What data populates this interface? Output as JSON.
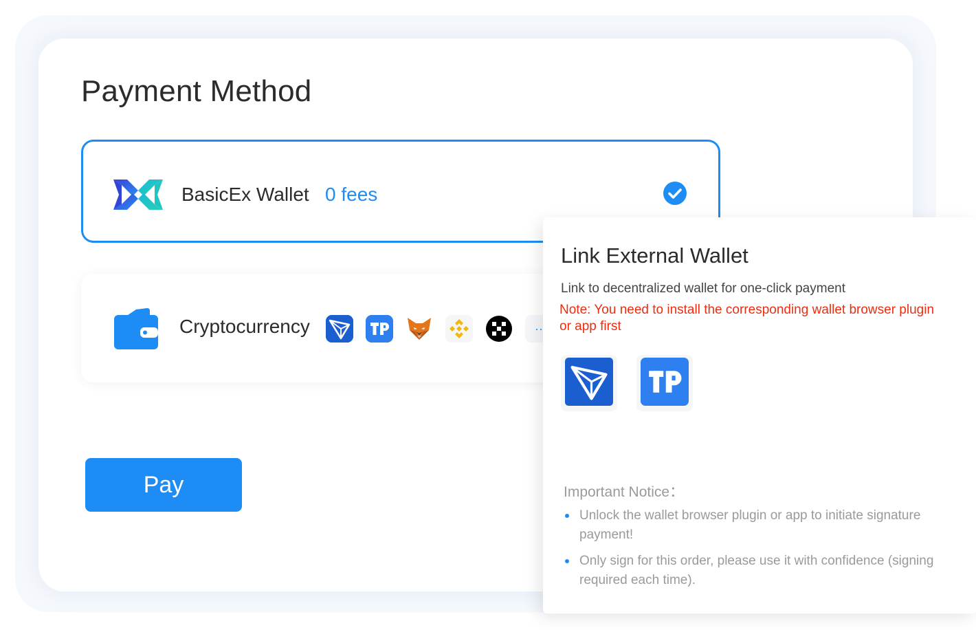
{
  "page": {
    "title": "Payment Method"
  },
  "options": {
    "basicex": {
      "label": "BasicEx Wallet",
      "fee": "0 fees",
      "logo_icon": "basicex-logo-icon",
      "selected": true
    },
    "crypto": {
      "label": "Cryptocurrency",
      "logo_icon": "wallet-icon",
      "wallet_icons": [
        "tronlink-icon",
        "tokenpocket-icon",
        "metamask-icon",
        "binance-icon",
        "okx-icon",
        "more-icon"
      ],
      "more_symbol": "··"
    }
  },
  "pay_button": {
    "label": "Pay"
  },
  "popup": {
    "title": "Link External Wallet",
    "description": "Link to decentralized wallet for one-click payment",
    "note": "Note: You need to install the corresponding wallet browser plugin or app first",
    "wallets": [
      "tronlink-icon",
      "tokenpocket-icon"
    ],
    "notice_heading": "Important Notice：",
    "notices": [
      "Unlock the wallet browser plugin or app to initiate signature payment!",
      "Only sign for this order, please use it with confidence (signing required each time)."
    ]
  },
  "colors": {
    "accent": "#1e8cf5",
    "note_red": "#ea2e12",
    "muted_text": "#9a9a9a"
  }
}
